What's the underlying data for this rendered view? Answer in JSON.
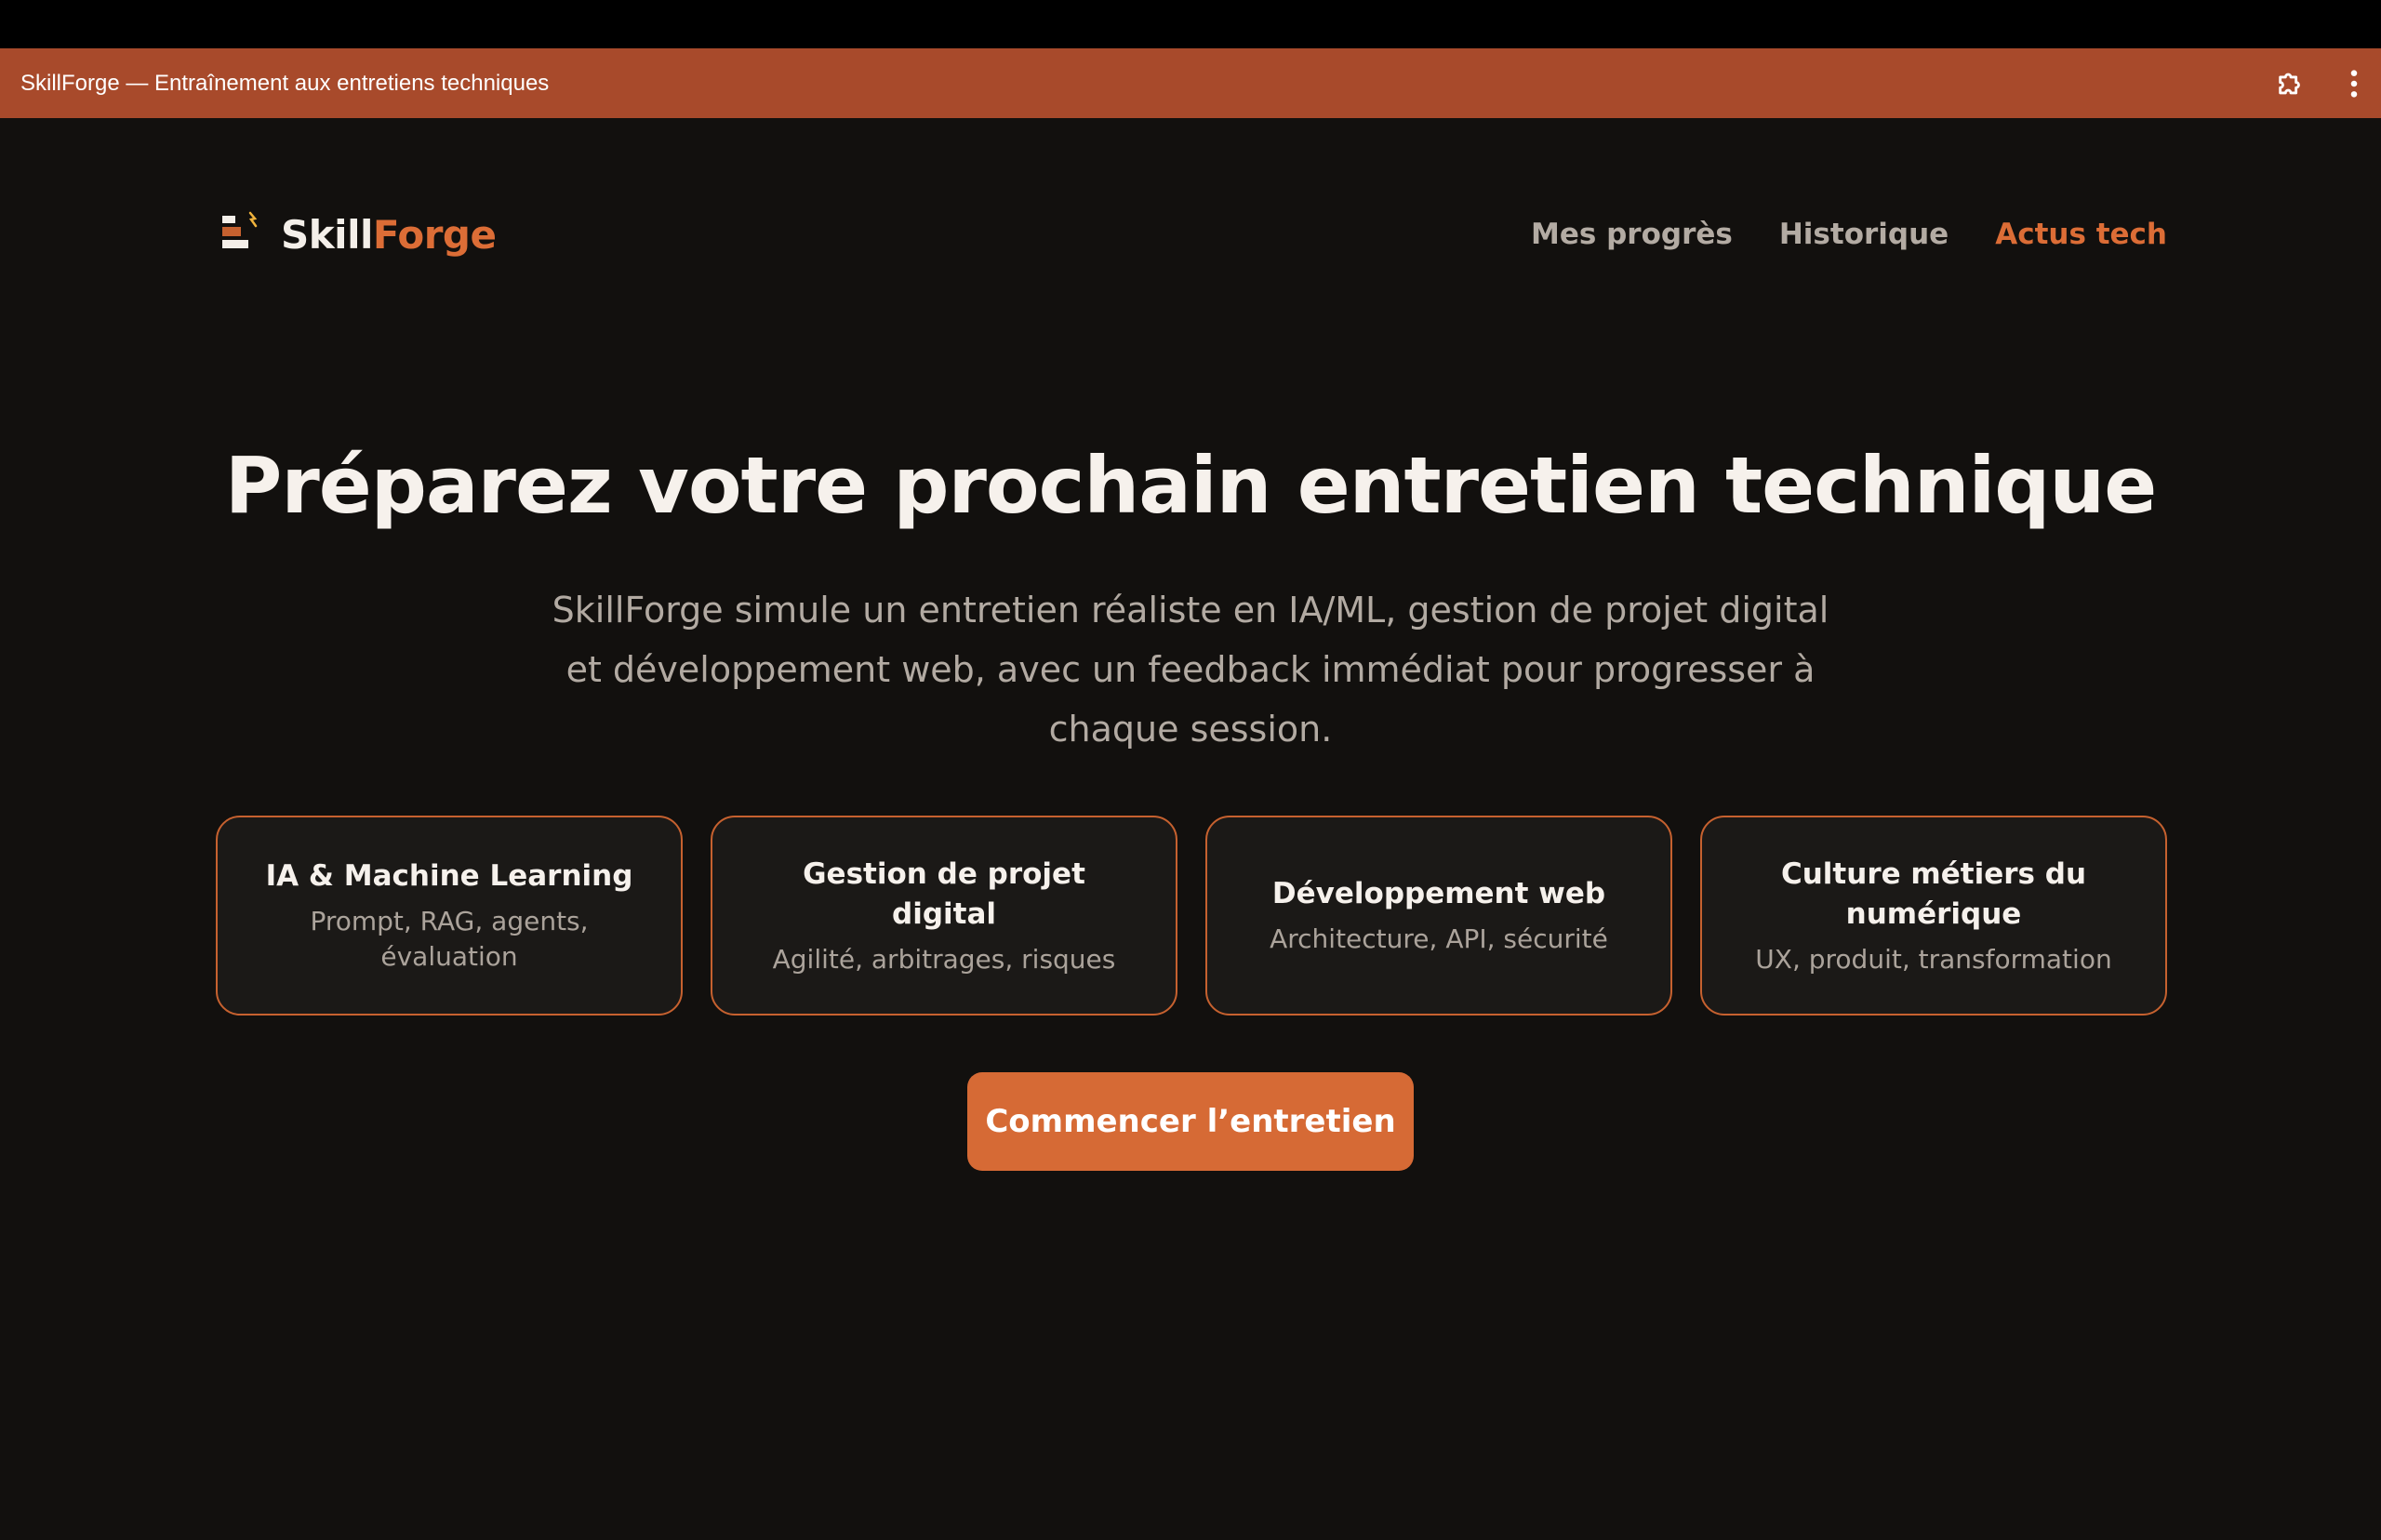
{
  "window": {
    "title": "SkillForge — Entraînement aux entretiens techniques",
    "titlebar_color": "#a84a2b",
    "icons": [
      "extension-icon",
      "more-vertical-icon"
    ]
  },
  "header": {
    "brand_part1": "Skill",
    "brand_part2": "Forge",
    "nav": [
      {
        "label": "Mes progrès"
      },
      {
        "label": "Historique"
      },
      {
        "label": "Actus tech",
        "active": true
      }
    ]
  },
  "hero": {
    "title": "Préparez votre prochain entretien technique",
    "subtitle": "SkillForge simule un entretien réaliste en IA/ML, gestion de projet digital et développement web, avec un feedback immédiat pour progresser à chaque session."
  },
  "cards": [
    {
      "title": "IA & Machine Learning",
      "desc": "Prompt, RAG, agents, évaluation"
    },
    {
      "title": "Gestion de projet digital",
      "desc": "Agilité, arbitrages, risques"
    },
    {
      "title": "Développement web",
      "desc": "Architecture, API, sécurité"
    },
    {
      "title": "Culture métiers du numérique",
      "desc": "UX, produit, transformation"
    }
  ],
  "cta": {
    "label": "Commencer l’entretien"
  },
  "colors": {
    "background": "#12100e",
    "accent": "#dc6d36",
    "card_bg": "#1b1917",
    "card_border": "#c6612f",
    "text": "#f6f1ec",
    "muted": "#b2aaa2"
  }
}
